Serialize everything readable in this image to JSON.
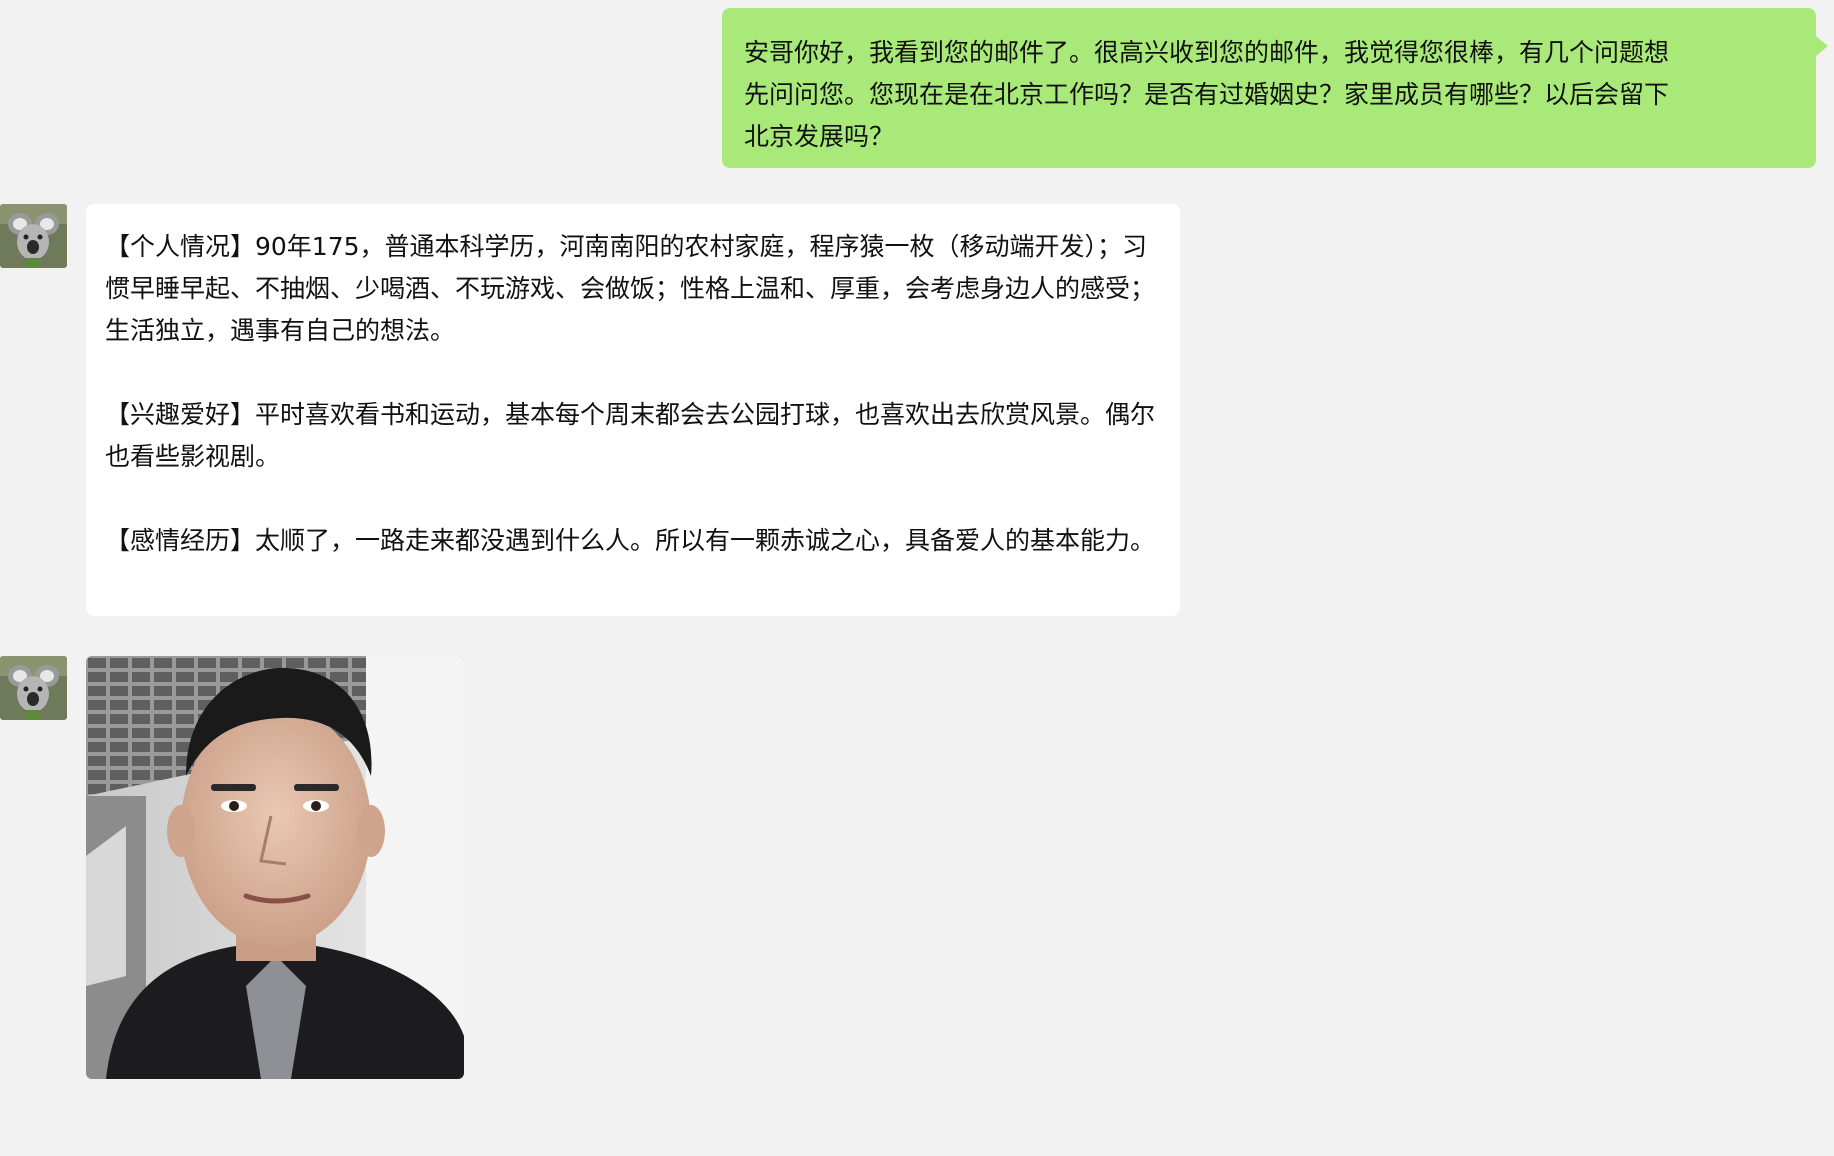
{
  "messages": [
    {
      "direction": "outgoing",
      "text": "安哥你好，我看到您的邮件了。很高兴收到您的邮件，我觉得您很棒，有几个问题想\n先问问您。您现在是在北京工作吗？是否有过婚姻史？家里成员有哪些？以后会留下\n北京发展吗？"
    },
    {
      "direction": "incoming",
      "paragraphs": [
        "【个人情况】90年175，普通本科学历，河南南阳的农村家庭，程序猿一枚（移动端开发）；习惯早睡早起、不抽烟、少喝酒、不玩游戏、会做饭；性格上温和、厚重，会考虑身边人的感受；生活独立，遇事有自己的想法。",
        "【兴趣爱好】平时喜欢看书和运动，基本每个周末都会去公园打球，也喜欢出去欣赏风景。偶尔也看些影视剧。",
        "【感情经历】太顺了，一路走来都没遇到什么人。所以有一颗赤诚之心，具备爱人的基本能力。"
      ]
    },
    {
      "direction": "incoming",
      "type": "image"
    }
  ],
  "colors": {
    "background": "#f2f2f2",
    "outgoing_bubble": "#a9e97a",
    "incoming_bubble": "#ffffff"
  },
  "icons": {
    "avatar": "koala-avatar-icon"
  }
}
